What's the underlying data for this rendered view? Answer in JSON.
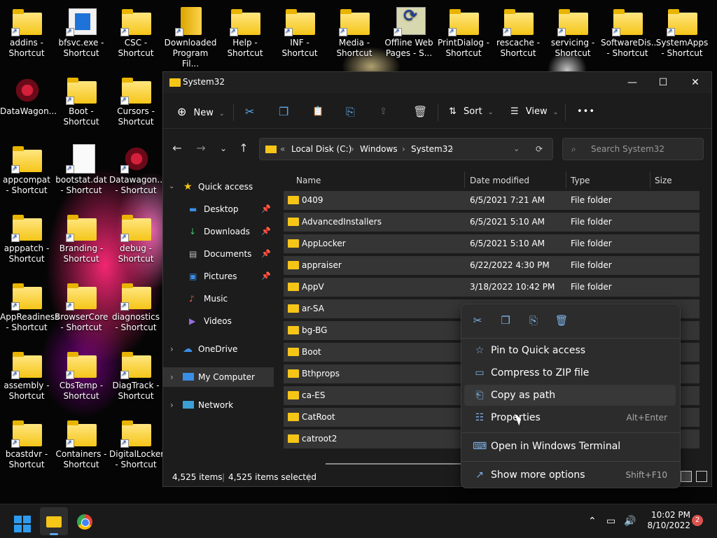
{
  "desktop": {
    "icons": [
      {
        "label": "addins - Shortcut",
        "icon": "folder-icon"
      },
      {
        "label": "bfsvc.exe - Shortcut",
        "icon": "app-icon"
      },
      {
        "label": "CSC - Shortcut",
        "icon": "folder-icon"
      },
      {
        "label": "Downloaded Program Fil...",
        "icon": "book-icon"
      },
      {
        "label": "Help - Shortcut",
        "icon": "folder-icon"
      },
      {
        "label": "INF - Shortcut",
        "icon": "folder-icon"
      },
      {
        "label": "Media - Shortcut",
        "icon": "folder-icon"
      },
      {
        "label": "Offline Web Pages - S...",
        "icon": "web-icon"
      },
      {
        "label": "PrintDialog - Shortcut",
        "icon": "folder-icon"
      },
      {
        "label": "rescache - Shortcut",
        "icon": "folder-icon"
      },
      {
        "label": "servicing - Shortcut",
        "icon": "folder-icon"
      },
      {
        "label": "SoftwareDis... - Shortcut",
        "icon": "folder-icon"
      },
      {
        "label": "SystemApps - Shortcut",
        "icon": "folder-icon"
      },
      {
        "label": "DataWagon...",
        "icon": "star-icon"
      },
      {
        "label": "Boot - Shortcut",
        "icon": "folder-icon"
      },
      {
        "label": "Cursors - Shortcut",
        "icon": "folder-icon"
      },
      {
        "label": "appcompat - Shortcut",
        "icon": "folder-icon"
      },
      {
        "label": "bootstat.dat - Shortcut",
        "icon": "doc-icon"
      },
      {
        "label": "Datawagon... - Shortcut",
        "icon": "star-icon"
      },
      {
        "label": "apppatch - Shortcut",
        "icon": "folder-icon"
      },
      {
        "label": "Branding - Shortcut",
        "icon": "folder-icon"
      },
      {
        "label": "debug - Shortcut",
        "icon": "folder-icon"
      },
      {
        "label": "AppReadiness - Shortcut",
        "icon": "folder-icon"
      },
      {
        "label": "BrowserCore - Shortcut",
        "icon": "folder-icon"
      },
      {
        "label": "diagnostics - Shortcut",
        "icon": "folder-icon"
      },
      {
        "label": "assembly - Shortcut",
        "icon": "folder-icon"
      },
      {
        "label": "CbsTemp - Shortcut",
        "icon": "folder-icon"
      },
      {
        "label": "DiagTrack - Shortcut",
        "icon": "folder-icon"
      },
      {
        "label": "bcastdvr - Shortcut",
        "icon": "folder-icon"
      },
      {
        "label": "Containers - Shortcut",
        "icon": "folder-icon"
      },
      {
        "label": "DigitalLocker - Shortcut",
        "icon": "folder-icon"
      }
    ]
  },
  "window": {
    "title": "System32",
    "minimize": "—",
    "maximize": "☐",
    "close": "✕"
  },
  "toolbar": {
    "new_label": "New",
    "sort_label": "Sort",
    "view_label": "View",
    "more_label": "•••"
  },
  "address": {
    "chevron": "«",
    "crumbs": [
      "Local Disk (C:)",
      "Windows",
      "System32"
    ],
    "search_placeholder": "Search System32"
  },
  "nav": {
    "quick_access": "Quick access",
    "items": [
      {
        "label": "Desktop",
        "icon": "desktop-icon"
      },
      {
        "label": "Downloads",
        "icon": "download-icon"
      },
      {
        "label": "Documents",
        "icon": "documents-icon"
      },
      {
        "label": "Pictures",
        "icon": "pictures-icon"
      },
      {
        "label": "Music",
        "icon": "music-icon"
      },
      {
        "label": "Videos",
        "icon": "videos-icon"
      }
    ],
    "onedrive": "OneDrive",
    "mycomputer": "My Computer",
    "network": "Network"
  },
  "files": {
    "columns": [
      "Name",
      "Date modified",
      "Type",
      "Size"
    ],
    "rows": [
      {
        "name": "0409",
        "date": "6/5/2021 7:21 AM",
        "type": "File folder"
      },
      {
        "name": "AdvancedInstallers",
        "date": "6/5/2021 5:10 AM",
        "type": "File folder"
      },
      {
        "name": "AppLocker",
        "date": "6/5/2021 5:10 AM",
        "type": "File folder"
      },
      {
        "name": "appraiser",
        "date": "6/22/2022 4:30 PM",
        "type": "File folder"
      },
      {
        "name": "AppV",
        "date": "3/18/2022 10:42 PM",
        "type": "File folder"
      },
      {
        "name": "ar-SA",
        "date": "",
        "type": ""
      },
      {
        "name": "bg-BG",
        "date": "",
        "type": ""
      },
      {
        "name": "Boot",
        "date": "",
        "type": ""
      },
      {
        "name": "Bthprops",
        "date": "",
        "type": ""
      },
      {
        "name": "ca-ES",
        "date": "",
        "type": ""
      },
      {
        "name": "CatRoot",
        "date": "",
        "type": ""
      },
      {
        "name": "catroot2",
        "date": "",
        "type": ""
      }
    ]
  },
  "status": {
    "items": "4,525 items",
    "selected": "4,525 items selected"
  },
  "context_menu": {
    "items": [
      {
        "label": "Pin to Quick access",
        "shortcut": "",
        "icon": "star-outline-icon"
      },
      {
        "label": "Compress to ZIP file",
        "shortcut": "",
        "icon": "zip-icon"
      },
      {
        "label": "Copy as path",
        "shortcut": "",
        "icon": "copy-path-icon"
      },
      {
        "label": "Properties",
        "shortcut": "Alt+Enter",
        "icon": "properties-icon"
      },
      {
        "label": "Open in Windows Terminal",
        "shortcut": "",
        "icon": "terminal-icon"
      },
      {
        "label": "Show more options",
        "shortcut": "Shift+F10",
        "icon": "more-options-icon"
      }
    ]
  },
  "taskbar": {
    "time": "10:02 PM",
    "date": "8/10/2022",
    "notifications": "2"
  },
  "colors": {
    "accent": "#5fa7e8",
    "folder": "#f5c518",
    "window_bg": "#1c1c1c",
    "menu_bg": "#2c2c2c"
  }
}
